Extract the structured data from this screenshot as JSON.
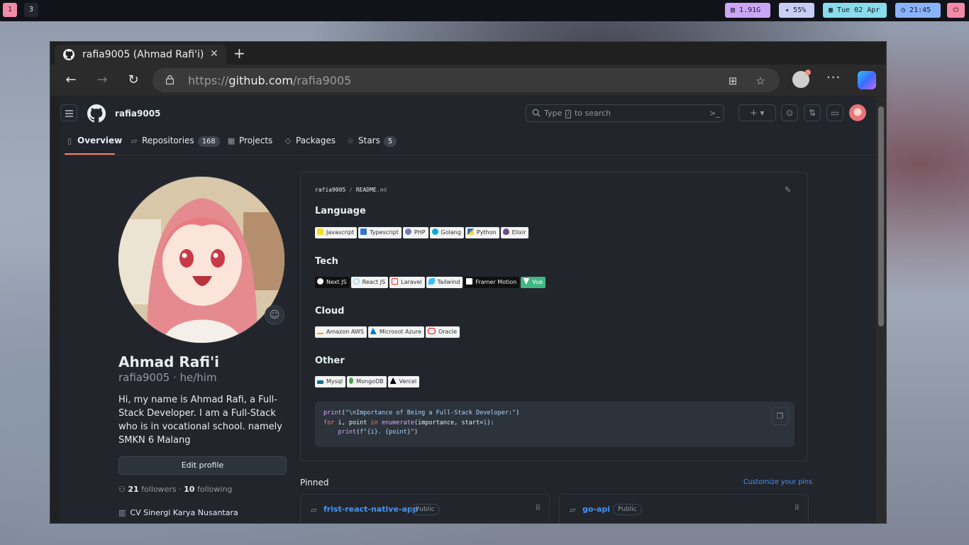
{
  "topbar": {
    "workspaces": [
      "1",
      "3"
    ],
    "memory": "1.91G",
    "volume": "55%",
    "date": "Tue 02 Apr",
    "time": "21:45",
    "icons": [
      "memory-icon",
      "volume-icon",
      "calendar-icon",
      "clock-icon",
      "power-icon"
    ]
  },
  "browser": {
    "tab_title": "rafia9005 (Ahmad Rafi'i)",
    "tab_close": "✕",
    "new_tab": "+",
    "url_scheme": "https://",
    "url_host": "github.com",
    "url_path": "/rafia9005",
    "more": "···"
  },
  "github": {
    "username": "rafia9005",
    "search_placeholder_pre": "Type",
    "search_placeholder_key": "/",
    "search_placeholder_post": "to search",
    "create_label": "+ ▾",
    "nav_tabs": [
      {
        "label": "Overview",
        "icon": "book-icon",
        "count": ""
      },
      {
        "label": "Repositories",
        "icon": "repo-icon",
        "count": "168"
      },
      {
        "label": "Projects",
        "icon": "table-icon",
        "count": ""
      },
      {
        "label": "Packages",
        "icon": "package-icon",
        "count": ""
      },
      {
        "label": "Stars",
        "icon": "star-icon",
        "count": "5"
      }
    ],
    "accent": "#f78166",
    "link_color": "#4493f8"
  },
  "profile": {
    "name": "Ahmad Rafi'i",
    "login": "rafia9005 · he/him",
    "bio": "Hi, my name is Ahmad Rafi, a Full-Stack Developer. I am a Full-Stack who is in vocational school. namely SMKN 6 Malang",
    "edit_button": "Edit profile",
    "followers": "21",
    "followers_label": "followers",
    "separator": "·",
    "following": "10",
    "following_label": "following",
    "organization": "CV Sinergi Karya Nusantara"
  },
  "readme": {
    "path_user": "rafia9005",
    "path_sep": "/",
    "path_file": "README",
    "path_ext": ".md",
    "sections": [
      {
        "title": "Language",
        "badges": [
          "Javascript",
          "Typescript",
          "PHP",
          "Golang",
          "Python",
          "Elixir"
        ]
      },
      {
        "title": "Tech",
        "badges": [
          "Next JS",
          "React JS",
          "Laravel",
          "Tailwind",
          "Framer Motion",
          "Vue"
        ]
      },
      {
        "title": "Cloud",
        "badges": [
          "Amazon AWS",
          "Microsot Azure",
          "Oracle"
        ]
      },
      {
        "title": "Other",
        "badges": [
          "Mysql",
          "MongoDB",
          "Vercel"
        ]
      }
    ],
    "code_lines": [
      "print(\"\\nImportance of Being a Full-Stack Developer:\")",
      "for i, point in enumerate(importance, start=1):",
      "    print(f\"{i}. {point}\")"
    ]
  },
  "pinned": {
    "heading": "Pinned",
    "customize": "Customize your pins",
    "repos": [
      {
        "name": "frist-react-native-app",
        "visibility": "Public"
      },
      {
        "name": "go-api",
        "visibility": "Public"
      }
    ]
  }
}
